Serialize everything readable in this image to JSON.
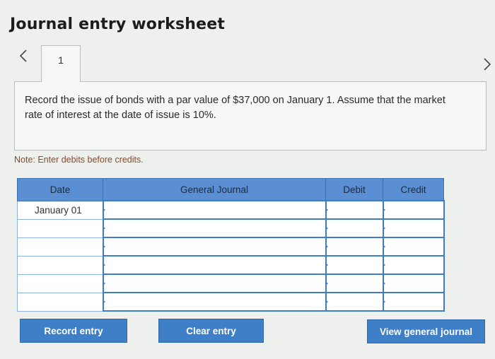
{
  "title": "Journal entry worksheet",
  "tabs": [
    {
      "label": "1"
    }
  ],
  "prompt": "Record the issue of bonds with a par value of $37,000 on January 1. Assume that the market rate of interest at the date of issue is 10%.",
  "note": "Note: Enter debits before credits.",
  "table": {
    "headers": [
      "Date",
      "General Journal",
      "Debit",
      "Credit"
    ],
    "rows": [
      {
        "date": "January 01"
      },
      {
        "date": ""
      },
      {
        "date": ""
      },
      {
        "date": ""
      },
      {
        "date": ""
      },
      {
        "date": ""
      }
    ]
  },
  "buttons": {
    "record": "Record entry",
    "clear": "Clear entry",
    "view": "View general journal"
  },
  "icons": {
    "prev": "chevron-left-icon",
    "next": "chevron-right-icon"
  },
  "colors": {
    "header_bg": "#5b8fd3",
    "button_bg": "#3e7fc7",
    "input_border": "#3d7cc9"
  }
}
